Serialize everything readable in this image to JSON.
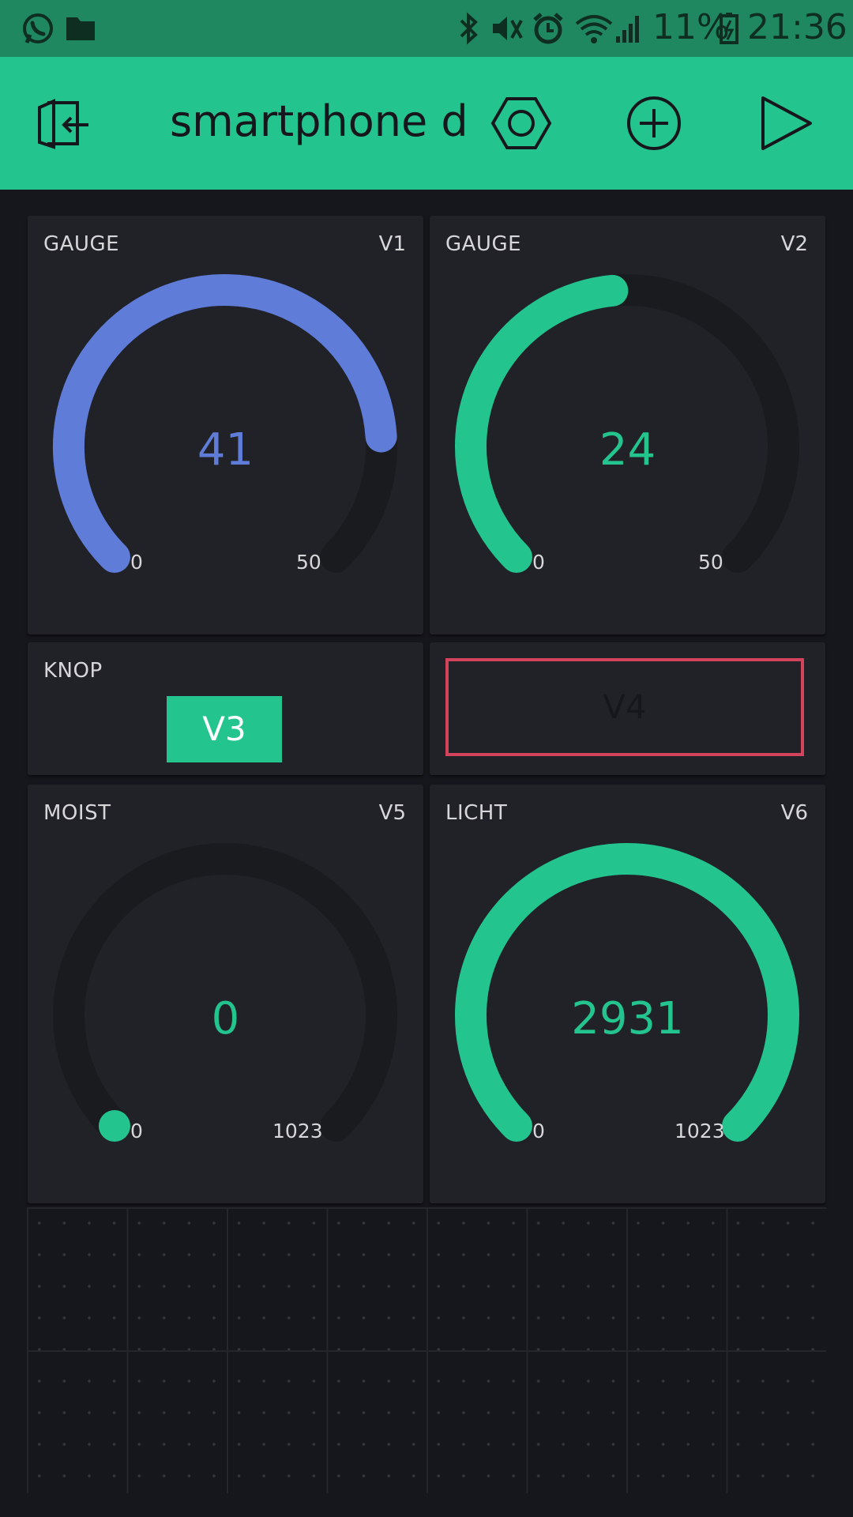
{
  "status_bar": {
    "battery": "11%",
    "time": "21:36",
    "icons": [
      "whatsapp-icon",
      "folder-icon",
      "bluetooth-icon",
      "mute-icon",
      "alarm-icon",
      "wifi-icon",
      "signal-icon",
      "battery-icon"
    ]
  },
  "app_bar": {
    "title": "smartphone d",
    "icons": [
      "exit-icon",
      "settings-icon",
      "add-icon",
      "play-icon"
    ]
  },
  "colors": {
    "green": "#23c48e",
    "blue": "#5f7cd8",
    "red": "#d3435c",
    "track": "#1a1b1f"
  },
  "widgets": {
    "gauge1": {
      "label": "GAUGE",
      "pin": "V1",
      "value": "41",
      "min": "0",
      "max": "50",
      "fraction": 0.82,
      "color": "#5f7cd8"
    },
    "gauge2": {
      "label": "GAUGE",
      "pin": "V2",
      "value": "24",
      "min": "0",
      "max": "50",
      "fraction": 0.48,
      "color": "#23c48e"
    },
    "button": {
      "label": "KNOP",
      "text": "V3"
    },
    "led": {
      "text": "V4"
    },
    "moist": {
      "label": "MOIST",
      "pin": "V5",
      "value": "0",
      "min": "0",
      "max": "1023",
      "fraction": 0.0,
      "color": "#23c48e"
    },
    "licht": {
      "label": "LICHT",
      "pin": "V6",
      "value": "2931",
      "min": "0",
      "max": "1023",
      "fraction": 1.0,
      "color": "#23c48e"
    }
  }
}
